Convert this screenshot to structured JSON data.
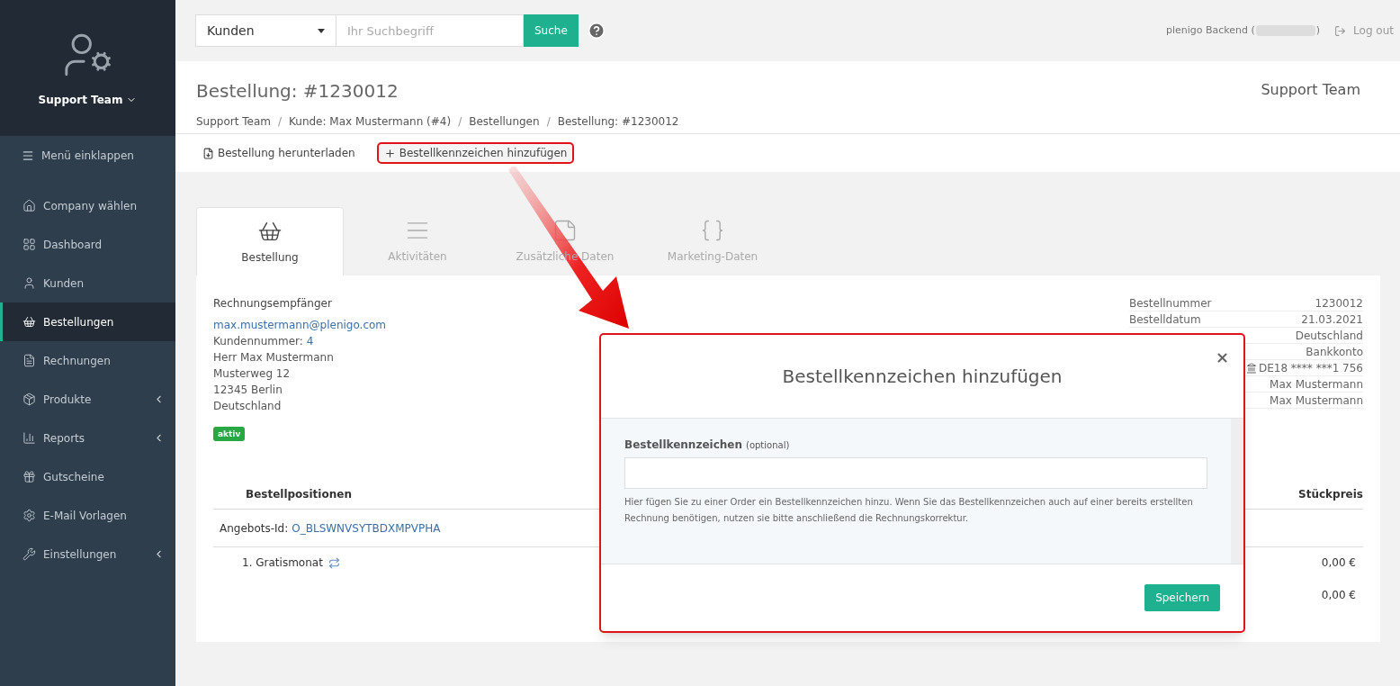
{
  "sidebar": {
    "team": "Support Team",
    "collapse": "Menü einklappen",
    "items": [
      {
        "label": "Company wählen",
        "selected": false,
        "expandable": false
      },
      {
        "label": "Dashboard",
        "selected": false,
        "expandable": false
      },
      {
        "label": "Kunden",
        "selected": false,
        "expandable": false
      },
      {
        "label": "Bestellungen",
        "selected": true,
        "expandable": false
      },
      {
        "label": "Rechnungen",
        "selected": false,
        "expandable": false
      },
      {
        "label": "Produkte",
        "selected": false,
        "expandable": true
      },
      {
        "label": "Reports",
        "selected": false,
        "expandable": true
      },
      {
        "label": "Gutscheine",
        "selected": false,
        "expandable": false
      },
      {
        "label": "E-Mail Vorlagen",
        "selected": false,
        "expandable": false
      },
      {
        "label": "Einstellungen",
        "selected": false,
        "expandable": true
      }
    ]
  },
  "topbar": {
    "scope": "Kunden",
    "placeholder": "Ihr Suchbegriff",
    "search_button": "Suche",
    "backend": "plenigo Backend (",
    "backend_end": ")",
    "logout": "Log out"
  },
  "header": {
    "title": "Bestellung: #1230012",
    "company": "Support Team",
    "separator": "/",
    "breadcrumbs": [
      "Support Team",
      "Kunde: Max Mustermann (#4)",
      "Bestellungen",
      "Bestellung: #1230012"
    ]
  },
  "actions": [
    {
      "label": "Bestellung herunterladen",
      "highlighted": false
    },
    {
      "label": "Bestellkennzeichen hinzufügen",
      "highlighted": true
    }
  ],
  "tabs": [
    {
      "label": "Bestellung",
      "selected": true
    },
    {
      "label": "Aktivitäten",
      "selected": false
    },
    {
      "label": "Zusätzliche Daten",
      "selected": false
    },
    {
      "label": "Marketing-Daten",
      "selected": false
    }
  ],
  "recipient": {
    "heading": "Rechnungsempfänger",
    "email": "max.mustermann@plenigo.com",
    "customer_no_label": "Kundennummer:",
    "customer_no": "4",
    "lines": [
      "Herr Max Mustermann",
      "Musterweg 12",
      "12345 Berlin",
      "Deutschland"
    ],
    "status": "aktiv"
  },
  "info": [
    {
      "label": "Bestellnummer",
      "value": "1230012"
    },
    {
      "label": "Bestelldatum",
      "value": "21.03.2021"
    },
    {
      "value": "Deutschland"
    },
    {
      "value": "Bankkonto"
    },
    {
      "value": "DE18 **** ***1 756",
      "kind": "bank"
    },
    {
      "value": "Max Mustermann"
    },
    {
      "value": "Max Mustermann"
    }
  ],
  "positions": {
    "heading": "Bestellpositionen",
    "price_heading": "Stückpreis",
    "offer_label": "Angebots-Id:",
    "offer_id": "O_BLSWNVSYTBDXMPVPHA",
    "items": [
      {
        "label": "1. Gratismonat",
        "price": "0,00 €"
      }
    ],
    "total": "0,00 €"
  },
  "modal": {
    "title": "Bestellkennzeichen hinzufügen",
    "close": "×",
    "field_label": "Bestellkennzeichen",
    "field_hint": "(optional)",
    "help": "Hier fügen Sie zu einer Order ein Bestellkennzeichen hinzu. Wenn Sie das Bestellkennzeichen auch auf einer bereits erstellten Rechnung benötigen, nutzen sie bitte anschließend die Rechnungskorrektur.",
    "save": "Speichern"
  }
}
